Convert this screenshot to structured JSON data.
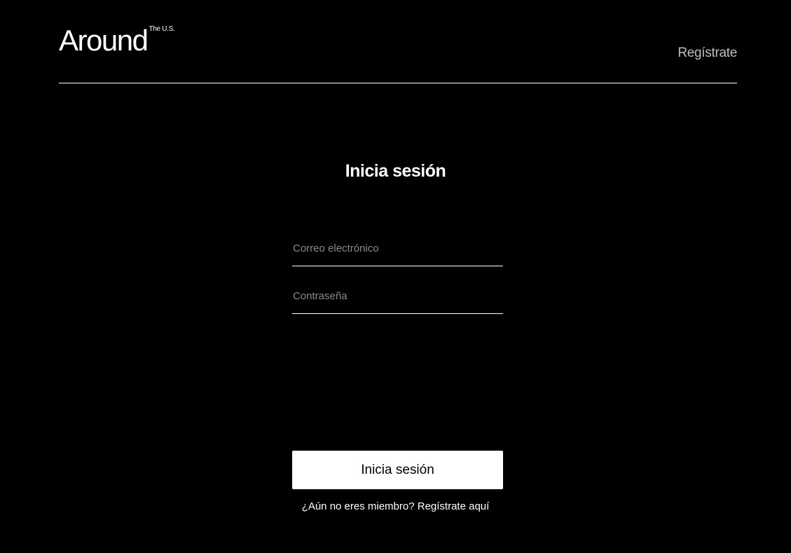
{
  "header": {
    "logo_text": "Around",
    "logo_superscript": "The U.S.",
    "register_link": "Regístrate"
  },
  "main": {
    "title": "Inicia sesión",
    "email_placeholder": "Correo electrónico",
    "password_placeholder": "Contraseña",
    "submit_label": "Inicia sesión",
    "signup_prompt": "¿Aún no eres miembro? Regístrate aquí"
  },
  "colors": {
    "background": "#000000",
    "text": "#ffffff",
    "muted": "#bdbdbd",
    "placeholder": "#8a8a8a",
    "button_bg": "#ffffff",
    "button_text": "#000000"
  }
}
